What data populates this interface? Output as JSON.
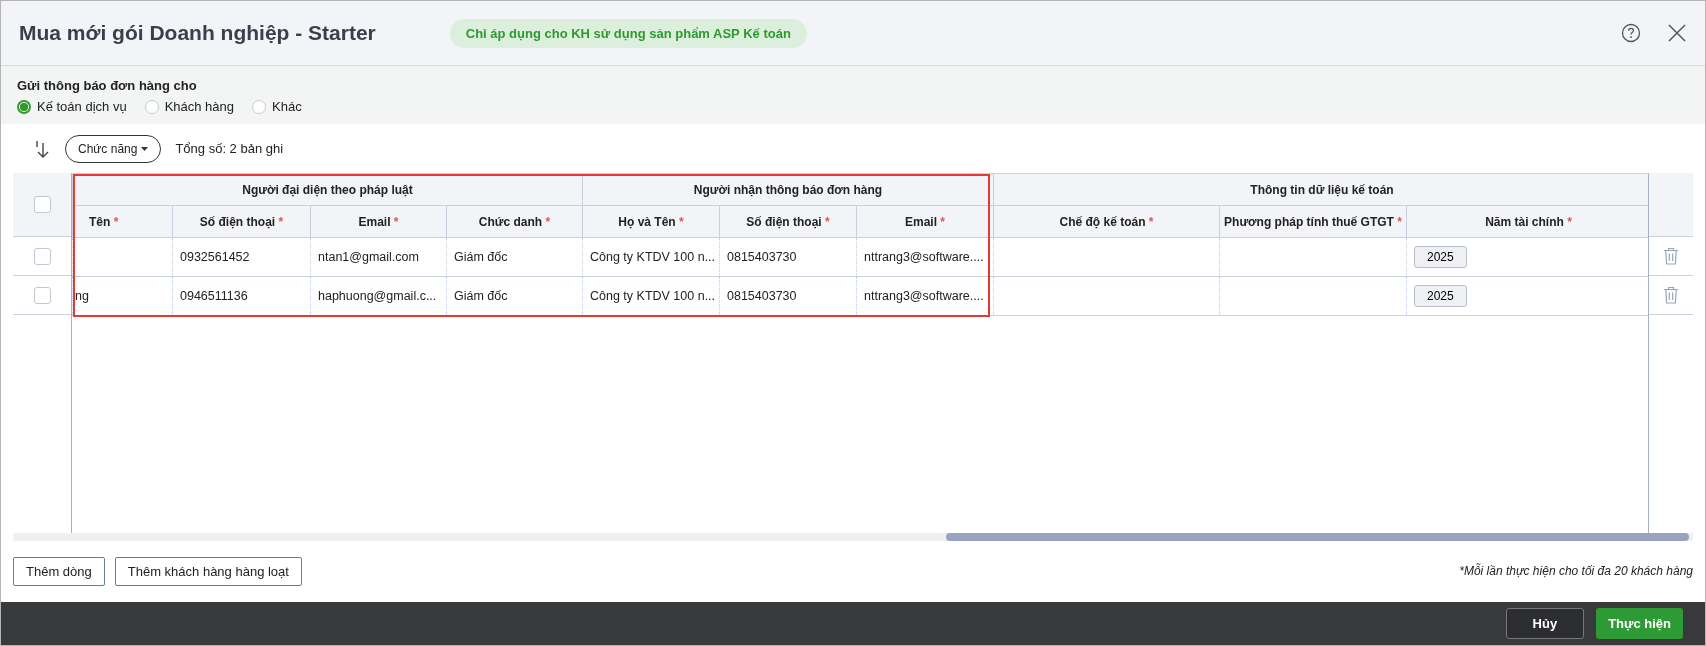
{
  "window": {
    "title": "Mua mới gói Doanh nghiệp - Starter",
    "badge": "Chỉ áp dụng cho KH sử dụng sản phẩm ASP Kế toán"
  },
  "notify": {
    "label": "Gửi thông báo đơn hàng cho",
    "options": [
      {
        "label": "Kế toán dịch vụ",
        "selected": true
      },
      {
        "label": "Khách hàng",
        "selected": false
      },
      {
        "label": "Khác",
        "selected": false
      }
    ]
  },
  "toolbar": {
    "menu_button": "Chức năng",
    "total": "Tổng số: 2 bản ghi"
  },
  "table": {
    "header_checked": false,
    "groups": [
      {
        "label": "Người đại diện theo pháp luật",
        "columns": [
          {
            "label": "Tên",
            "mark": "*",
            "kind": "text"
          },
          {
            "label": "Số điện thoại",
            "mark": "*",
            "kind": "text"
          },
          {
            "label": "Email",
            "mark": "*",
            "kind": "text"
          },
          {
            "label": "Chức danh",
            "mark": "*",
            "kind": "text"
          }
        ]
      },
      {
        "label": "Người nhận thông báo đơn hàng",
        "columns": [
          {
            "label": "Họ và Tên",
            "mark": "*",
            "kind": "text"
          },
          {
            "label": "Số điện thoại",
            "mark": "*",
            "kind": "text"
          },
          {
            "label": "Email",
            "mark": "*",
            "kind": "text"
          }
        ]
      },
      {
        "label": "Thông tin dữ liệu kế toán",
        "columns": [
          {
            "label": "Chế độ kế toán",
            "mark": "*",
            "kind": "text"
          },
          {
            "label": "Phương pháp tính thuế GTGT",
            "mark": "*",
            "kind": "text"
          },
          {
            "label": "Năm tài chính",
            "mark": "*",
            "kind": "button"
          }
        ]
      }
    ],
    "rows": [
      {
        "checked": false,
        "cells": [
          null,
          "0932561452",
          "ntan1@gmail.com",
          "Giám đốc",
          "Công ty KTDV 100 n...",
          "0815403730",
          "nttrang3@software....",
          null,
          null,
          "2025"
        ]
      },
      {
        "checked": false,
        "cells": [
          "ng",
          "0946511136",
          "haphuong@gmail.c...",
          "Giám đốc",
          "Công ty KTDV 100 n...",
          "0815403730",
          "nttrang3@software....",
          null,
          null,
          "2025"
        ]
      }
    ]
  },
  "actions": {
    "add_row": "Thêm dòng",
    "add_bulk": "Thêm khách hàng hàng loạt",
    "note": "*Mỗi lần thực hiện cho tối đa 20 khách hàng"
  },
  "footer": {
    "cancel": "Hủy",
    "submit": "Thực hiện"
  }
}
